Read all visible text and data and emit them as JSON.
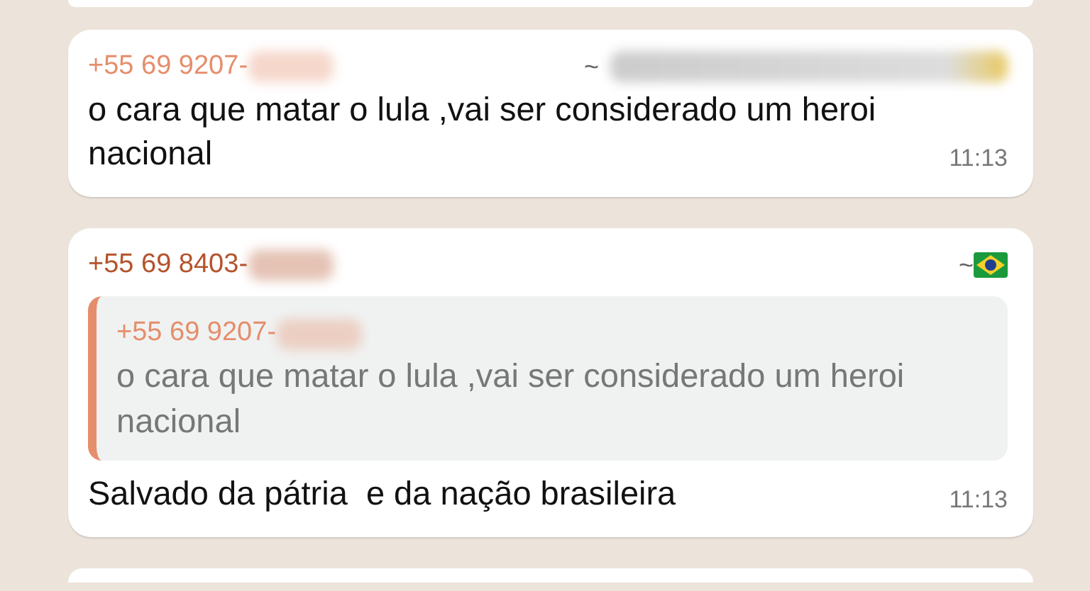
{
  "messages": [
    {
      "sender": "+55 69 9207-",
      "color": "#e58e6c",
      "push_name": "~",
      "push_badge": {
        "kind": "blurred"
      },
      "text": "o cara que matar o lula ,vai ser considerado um heroi nacional",
      "time": "11:13"
    },
    {
      "sender": "+55 69 8403-",
      "color": "#b4532c",
      "push_name": "~",
      "push_badge": {
        "kind": "flag"
      },
      "quote": {
        "sender": "+55 69 9207-",
        "color": "#e58e6c",
        "text": "o cara que matar o lula ,vai ser considerado um heroi nacional"
      },
      "text": "Salvado da pátria  e da nação brasileira",
      "time": "11:13"
    }
  ]
}
